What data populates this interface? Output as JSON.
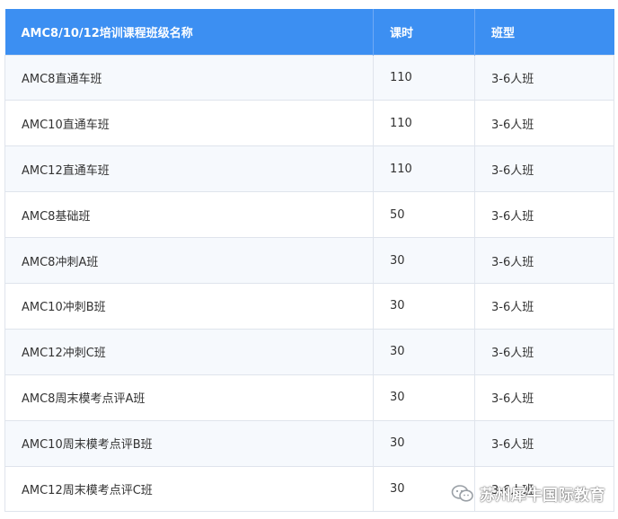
{
  "table": {
    "headers": [
      "AMC8/10/12培训课程班级名称",
      "课时",
      "班型"
    ],
    "rows": [
      [
        "AMC8直通车班",
        "110",
        "3-6人班"
      ],
      [
        "AMC10直通车班",
        "110",
        "3-6人班"
      ],
      [
        "AMC12直通车班",
        "110",
        "3-6人班"
      ],
      [
        "AMC8基础班",
        "50",
        "3-6人班"
      ],
      [
        "AMC8冲刺A班",
        "30",
        "3-6人班"
      ],
      [
        "AMC10冲刺B班",
        "30",
        "3-6人班"
      ],
      [
        "AMC12冲刺C班",
        "30",
        "3-6人班"
      ],
      [
        "AMC8周末模考点评A班",
        "30",
        "3-6人班"
      ],
      [
        "AMC10周末模考点评B班",
        "30",
        "3-6人班"
      ],
      [
        "AMC12周末模考点评C班",
        "30",
        "3-6人班"
      ]
    ]
  },
  "watermark": {
    "text": "苏州犀牛国际教育",
    "icon": "wechat-icon"
  },
  "colors": {
    "header_bg": "#3c8ff2",
    "header_text": "#ffffff",
    "row_alt_bg": "#f6f9fd",
    "border": "#dfe4ec"
  }
}
